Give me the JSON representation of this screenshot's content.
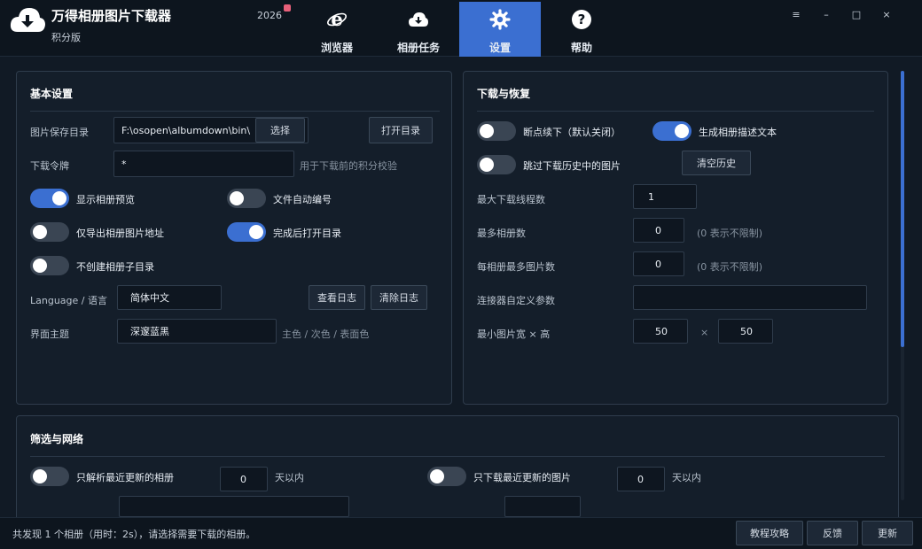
{
  "header": {
    "app_title": "万得相册图片下载器",
    "app_subtitle": "积分版",
    "year": "2026",
    "tabs": [
      {
        "label": "浏览器",
        "icon": "ie-browser-icon"
      },
      {
        "label": "相册任务",
        "icon": "cloud-download-icon"
      },
      {
        "label": "设置",
        "icon": "gear-icon"
      },
      {
        "label": "帮助",
        "icon": "help-icon"
      }
    ],
    "window_controls": {
      "menu": "≡",
      "minimize": "–",
      "maximize": "□",
      "close": "×"
    }
  },
  "basic": {
    "title": "基本设置",
    "save_dir_label": "图片保存目录",
    "save_dir_value": "F:\\osopen\\albumdown\\bin\\",
    "choose_btn": "选择",
    "open_dir_btn": "打开目录",
    "token_label": "下载令牌",
    "token_value": "*",
    "token_hint": "用于下载前的积分校验",
    "toggles": [
      {
        "label": "显示相册预览",
        "on": true
      },
      {
        "label": "文件自动编号",
        "on": false
      },
      {
        "label": "仅导出相册图片地址",
        "on": false
      },
      {
        "label": "完成后打开目录",
        "on": true
      },
      {
        "label": "不创建相册子目录",
        "on": false
      }
    ],
    "language_label": "Language / 语言",
    "language_value": "简体中文",
    "view_log_btn": "查看日志",
    "clear_log_btn": "清除日志",
    "theme_label": "界面主题",
    "theme_value": "深邃蓝黑",
    "theme_hint": "主色 / 次色 / 表面色"
  },
  "download": {
    "title": "下载与恢复",
    "toggles": [
      {
        "label": "断点续下（默认关闭）",
        "on": false
      },
      {
        "label": "生成相册描述文本",
        "on": true
      },
      {
        "label": "跳过下载历史中的图片",
        "on": false
      }
    ],
    "clear_history_btn": "清空历史",
    "threads_label": "最大下载线程数",
    "threads_value": "1",
    "max_albums_label": "最多相册数",
    "max_albums_value": "0",
    "max_albums_hint": "(0 表示不限制)",
    "max_pics_label": "每相册最多图片数",
    "max_pics_value": "0",
    "max_pics_hint": "(0 表示不限制)",
    "connector_label": "连接器自定义参数",
    "connector_value": "",
    "min_size_label": "最小图片宽 × 高",
    "min_width": "50",
    "times": "×",
    "min_height": "50"
  },
  "filter": {
    "title": "筛选与网络",
    "recent_albums_label": "只解析最近更新的相册",
    "recent_albums_on": false,
    "recent_albums_days": "0",
    "recent_pics_label": "只下载最近更新的图片",
    "recent_pics_on": false,
    "recent_pics_days": "0",
    "days_unit": "天以内"
  },
  "footer": {
    "status": "共发现 1 个相册（用时：2s），请选择需要下载的相册。",
    "tutorial_btn": "教程攻略",
    "feedback_btn": "反馈",
    "update_btn": "更新"
  },
  "colors": {
    "accent": "#3b6fd1",
    "background": "#111a25",
    "panel": "#141e2a"
  }
}
